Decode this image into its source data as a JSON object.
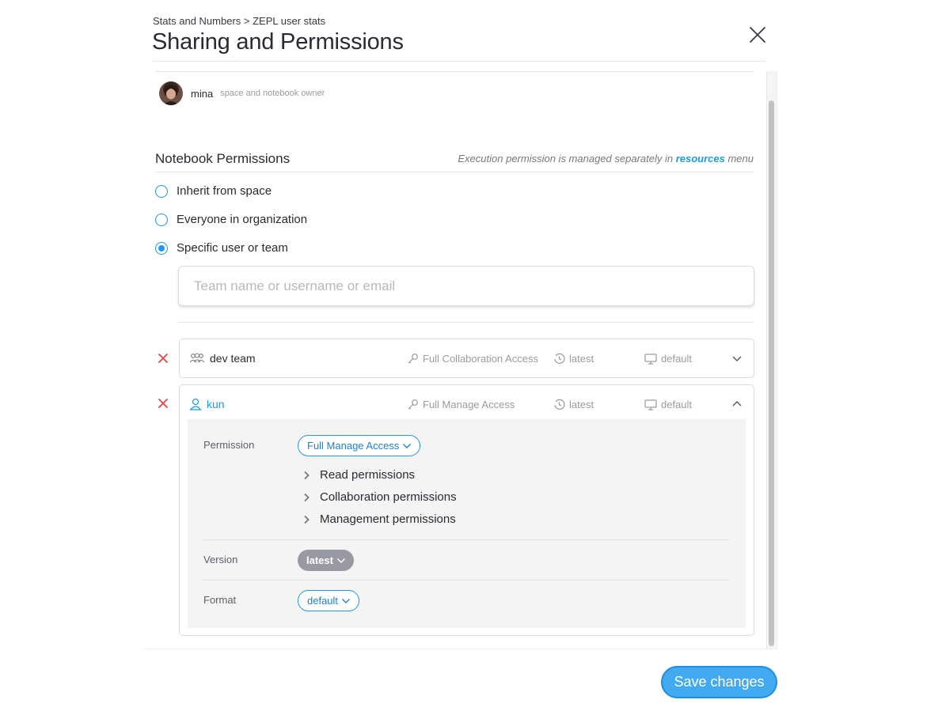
{
  "header": {
    "breadcrumb": "Stats and Numbers > ZEPL user stats",
    "title": "Sharing and Permissions"
  },
  "owner": {
    "name": "mina",
    "role": "space and notebook owner"
  },
  "notebook_permissions": {
    "title": "Notebook Permissions",
    "exec_note_prefix": "Execution permission is managed separately in ",
    "exec_note_link": "resources",
    "exec_note_suffix": " menu",
    "options": [
      {
        "label": "Inherit from space",
        "selected": false
      },
      {
        "label": "Everyone in organization",
        "selected": false
      },
      {
        "label": "Specific user or team",
        "selected": true
      }
    ],
    "search_placeholder": "Team name or username or email"
  },
  "members": [
    {
      "name": "dev team",
      "kind": "team",
      "access": "Full Collaboration Access",
      "version": "latest",
      "format": "default",
      "expanded": false
    },
    {
      "name": "kun",
      "kind": "user",
      "access": "Full Manage Access",
      "version": "latest",
      "format": "default",
      "expanded": true,
      "detail": {
        "permission_label": "Permission",
        "permission_value": "Full Manage Access",
        "permission_groups": [
          "Read permissions",
          "Collaboration permissions",
          "Management permissions"
        ],
        "version_label": "Version",
        "version_value": "latest",
        "format_label": "Format",
        "format_value": "default"
      }
    }
  ],
  "footer": {
    "save_label": "Save changes"
  },
  "colors": {
    "accent": "#2196f3",
    "link": "#1f9ae0",
    "remove": "#e64545",
    "save_button": "#42aaf0"
  },
  "icons": [
    "close-icon",
    "avatar",
    "team-icon",
    "user-icon",
    "key-icon",
    "history-icon",
    "monitor-icon",
    "chevron-down-icon",
    "chevron-up-icon",
    "chevron-right-icon",
    "remove-icon"
  ]
}
